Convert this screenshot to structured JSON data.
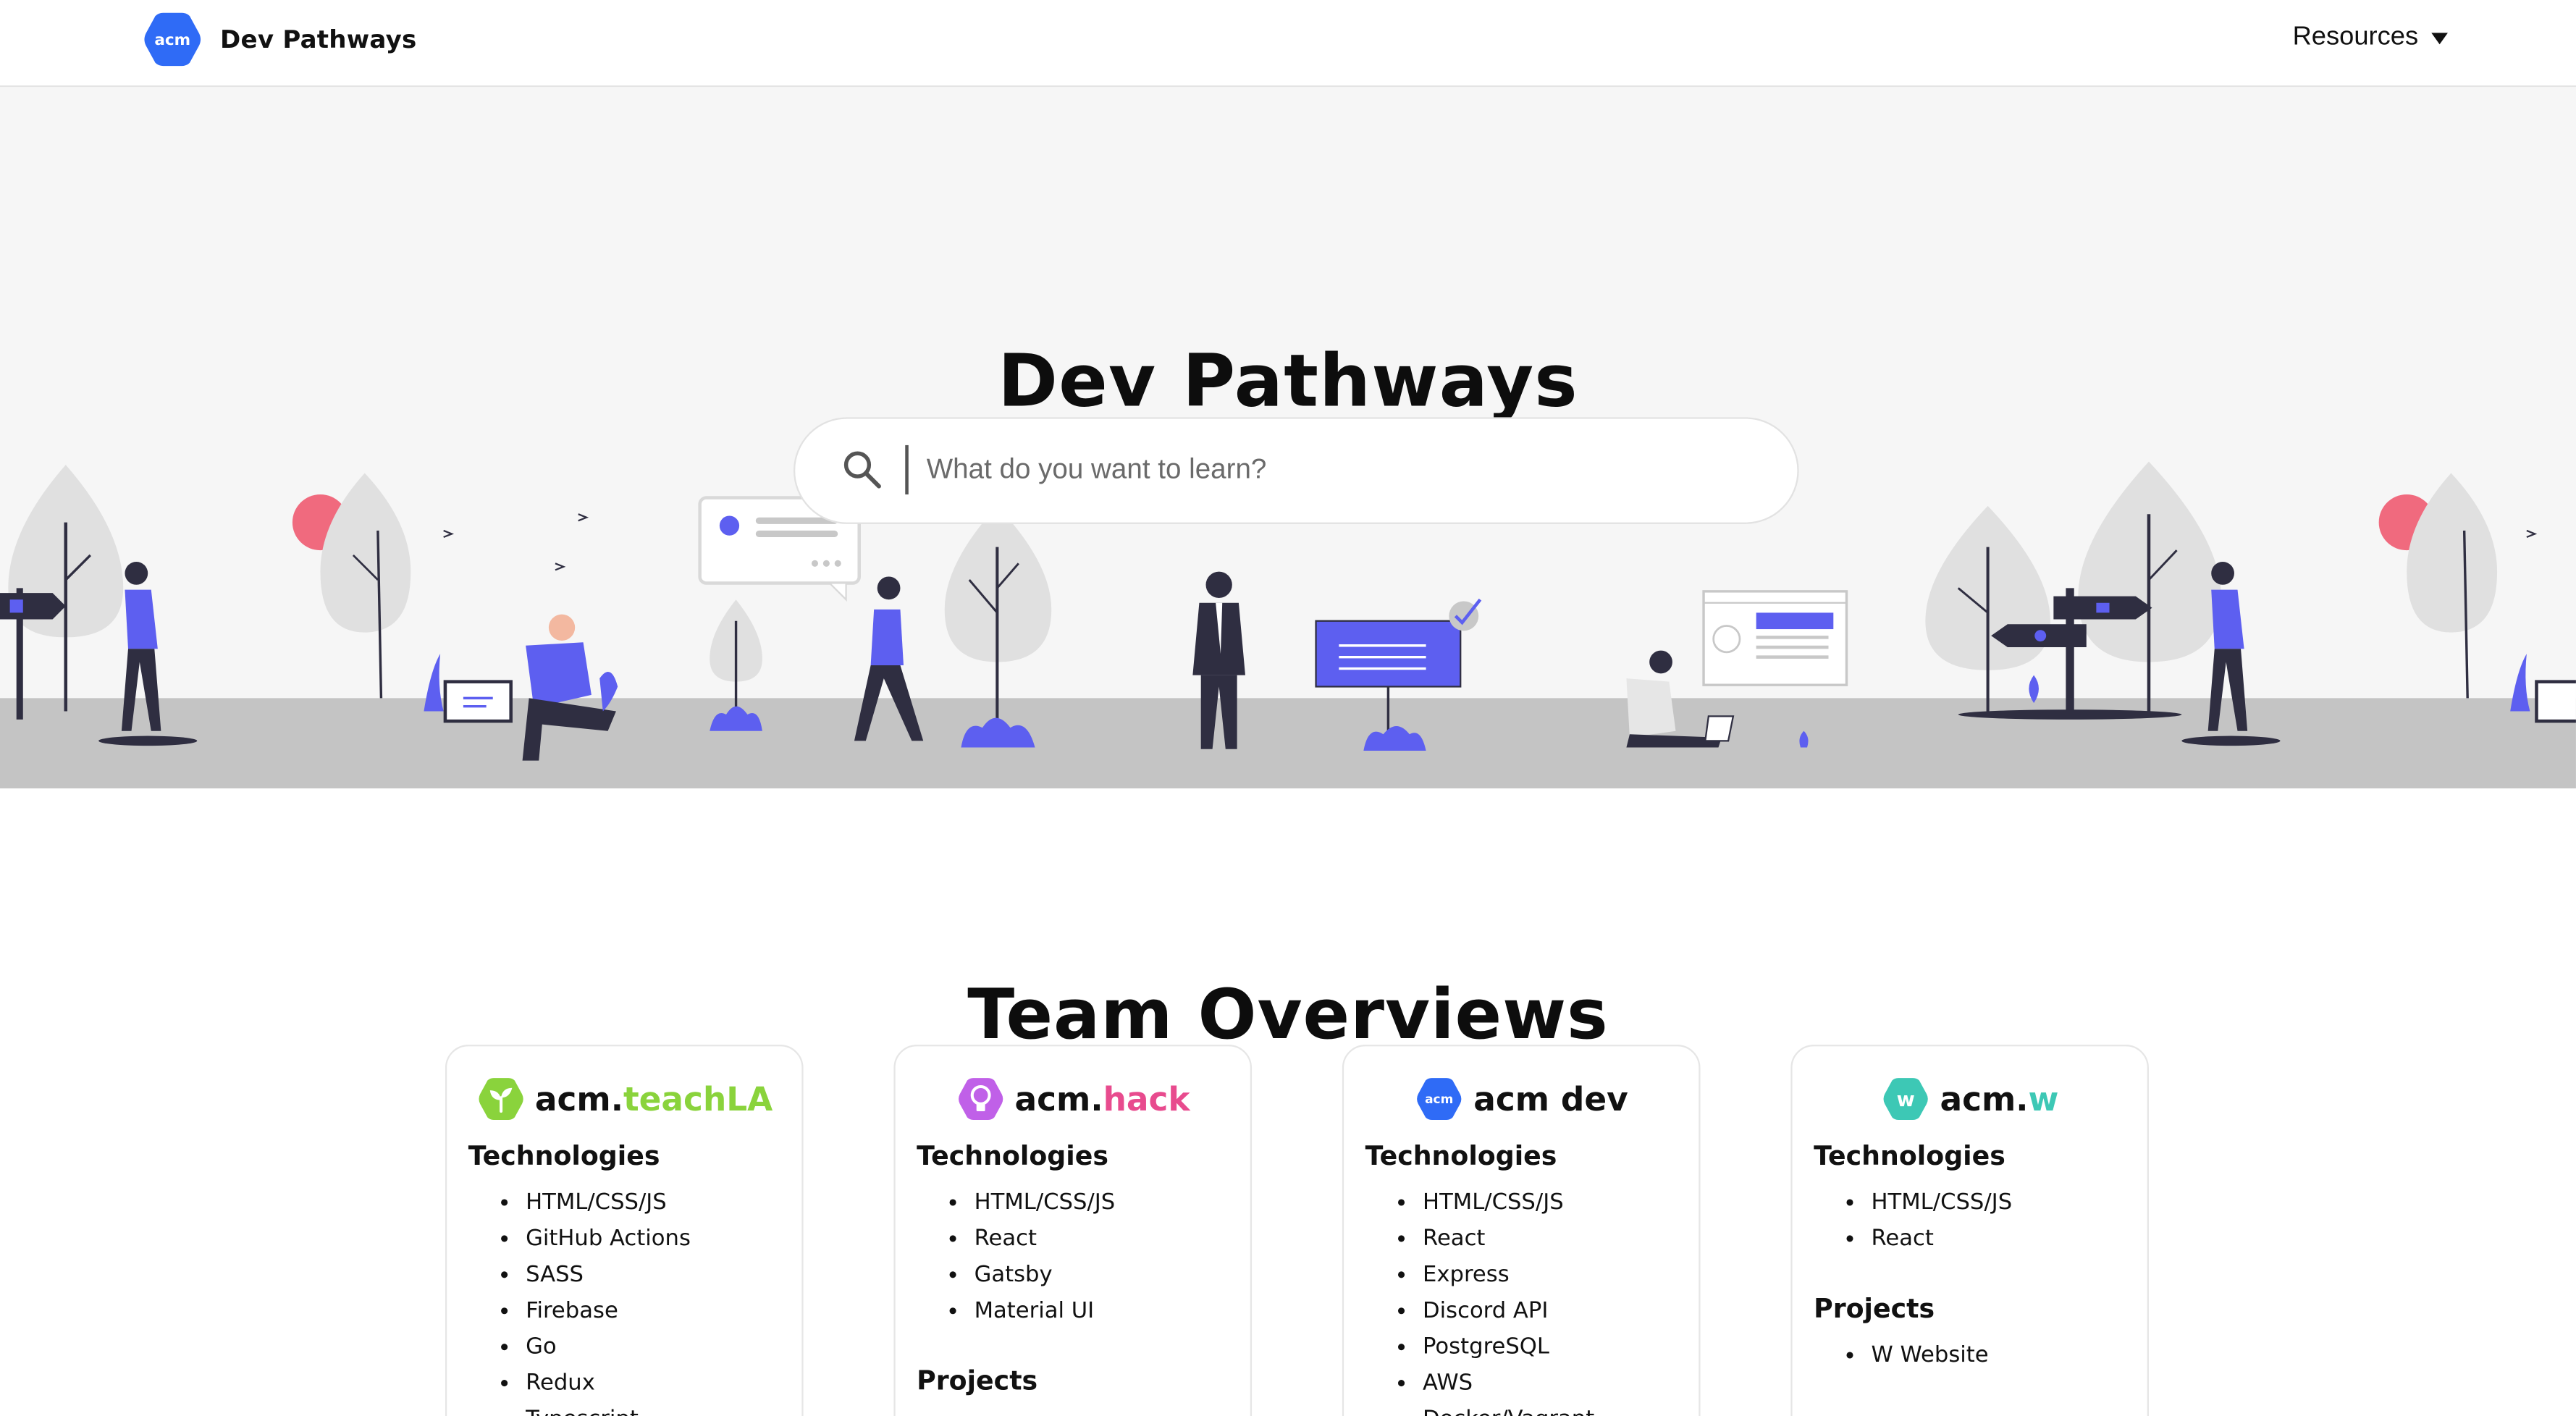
{
  "nav": {
    "brand_logo_text": "acm",
    "brand_title": "Dev Pathways",
    "dropdown_label": "Resources"
  },
  "hero": {
    "title": "Dev Pathways",
    "search_placeholder": "What do you want to learn?",
    "search_value": ""
  },
  "section": {
    "title": "Team Overviews"
  },
  "teams": [
    {
      "logo_text": "",
      "name_prefix": "acm.",
      "name_suffix": "teachLA",
      "accent": "#8ad33c",
      "technologies_heading": "Technologies",
      "technologies": [
        "HTML/CSS/JS",
        "GitHub Actions",
        "SASS",
        "Firebase",
        "Go",
        "Redux",
        "Typescript"
      ],
      "projects_heading": "",
      "projects": []
    },
    {
      "logo_text": "",
      "name_prefix": "acm.",
      "name_suffix": "hack",
      "accent": "#e84b8e",
      "technologies_heading": "Technologies",
      "technologies": [
        "HTML/CSS/JS",
        "React",
        "Gatsby",
        "Material UI"
      ],
      "projects_heading": "Projects",
      "projects": []
    },
    {
      "logo_text": "acm",
      "name_prefix": "acm dev",
      "name_suffix": "",
      "accent": "#2f6bf6",
      "technologies_heading": "Technologies",
      "technologies": [
        "HTML/CSS/JS",
        "React",
        "Express",
        "Discord API",
        "PostgreSQL",
        "AWS",
        "Docker/Vagrant"
      ],
      "projects_heading": "",
      "projects": []
    },
    {
      "logo_text": "w",
      "name_prefix": "acm.",
      "name_suffix": "w",
      "accent": "#3dc8b5",
      "technologies_heading": "Technologies",
      "technologies": [
        "HTML/CSS/JS",
        "React"
      ],
      "projects_heading": "Projects",
      "projects": [
        "W Website"
      ]
    }
  ],
  "colors": {
    "acm_blue": "#2f6bf6",
    "illustration_accent": "#5d5ff0",
    "illustration_pink": "#f06a7e",
    "hero_bg": "#f6f6f6",
    "ground": "#c4c4c4"
  },
  "icons": {
    "search": "magnifier-icon",
    "dropdown": "caret-down-icon"
  }
}
